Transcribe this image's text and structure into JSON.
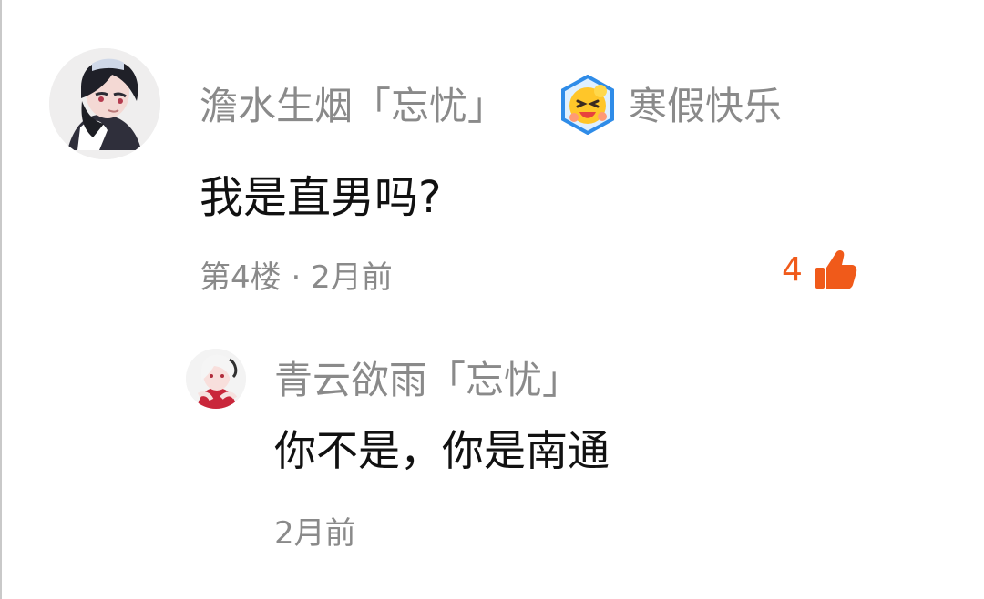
{
  "comment": {
    "username": "澹水生烟「忘忧」",
    "badge_label": "寒假快乐",
    "badge_icon": "smiley-badge-icon",
    "text": "我是直男吗?",
    "floor": "第4楼",
    "separator": "·",
    "time": "2月前",
    "likes": "4",
    "like_icon": "thumbs-up-icon"
  },
  "reply": {
    "username": "青云欲雨「忘忧」",
    "text": "你不是，你是南通",
    "time": "2月前"
  },
  "colors": {
    "username_gray": "#8a8a8a",
    "text_black": "#111111",
    "like_orange": "#f05a1a",
    "badge_blue": "#2f8ce8",
    "badge_yellow": "#ffc629"
  }
}
